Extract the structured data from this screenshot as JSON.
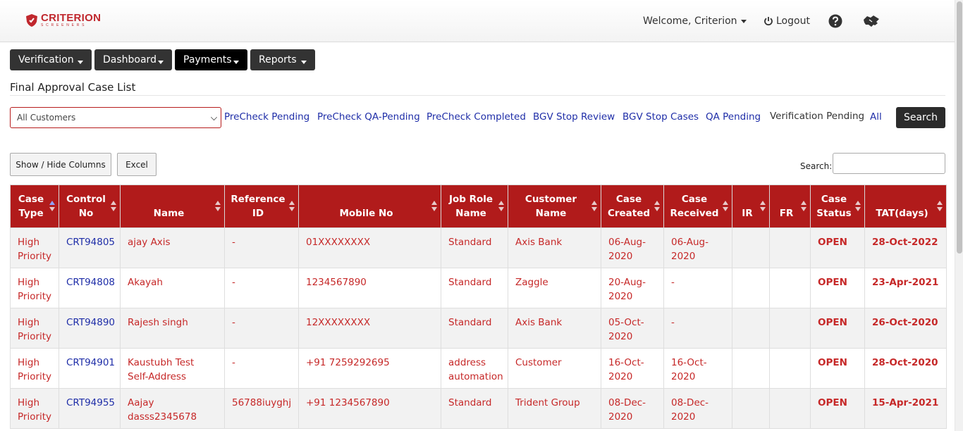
{
  "header": {
    "brand_name": "CRITERION",
    "brand_sub": "SCREENERS",
    "welcome": "Welcome, Criterion",
    "logout": "Logout"
  },
  "nav": [
    {
      "label": "Verification"
    },
    {
      "label": "Dashboard"
    },
    {
      "label": "Payments"
    },
    {
      "label": "Reports"
    }
  ],
  "page_title": "Final Approval Case List",
  "filters": {
    "customer_selected": "All Customers",
    "links": [
      "PreCheck Pending",
      "PreCheck QA-Pending",
      "PreCheck Completed",
      "BGV Stop Review",
      "BGV Stop Cases",
      "QA Pending",
      "Verification Pending",
      "All"
    ],
    "search_button": "Search"
  },
  "tools": {
    "show_hide": "Show / Hide Columns",
    "excel": "Excel",
    "search_label": "Search:"
  },
  "colors": {
    "header_red": "#b11b1b",
    "text_red": "#c62828",
    "link_blue": "#1f2ea8",
    "dark_button": "#2b2b2b"
  },
  "table": {
    "columns": [
      "Case Type",
      "Control No",
      "Name",
      "Reference ID",
      "Mobile No",
      "Job Role Name",
      "Customer Name",
      "Case Created",
      "Case Received",
      "IR",
      "FR",
      "Case Status",
      "TAT(days)"
    ],
    "rows": [
      [
        "High Priority",
        "CRT94805",
        "ajay Axis",
        "-",
        "01XXXXXXXX",
        "Standard",
        "Axis Bank",
        "06-Aug-2020",
        "06-Aug-2020",
        "",
        "",
        "OPEN",
        "28-Oct-2022"
      ],
      [
        "High Priority",
        "CRT94808",
        "Akayah",
        "-",
        "1234567890",
        "Standard",
        "Zaggle",
        "20-Aug-2020",
        "-",
        "",
        "",
        "OPEN",
        "23-Apr-2021"
      ],
      [
        "High Priority",
        "CRT94890",
        "Rajesh singh",
        "-",
        "12XXXXXXXX",
        "Standard",
        "Axis Bank",
        "05-Oct-2020",
        "-",
        "",
        "",
        "OPEN",
        "26-Oct-2020"
      ],
      [
        "High Priority",
        "CRT94901",
        "Kaustubh Test Self-Address",
        "-",
        "+91 7259292695",
        "address automation",
        "Customer",
        "16-Oct-2020",
        "16-Oct-2020",
        "",
        "",
        "OPEN",
        "28-Oct-2020"
      ],
      [
        "High Priority",
        "CRT94955",
        "Aajay dasss2345678",
        "56788iuyghj",
        "+91 1234567890",
        "Standard",
        "Trident Group",
        "08-Dec-2020",
        "08-Dec-2020",
        "",
        "",
        "OPEN",
        "15-Apr-2021"
      ]
    ]
  }
}
